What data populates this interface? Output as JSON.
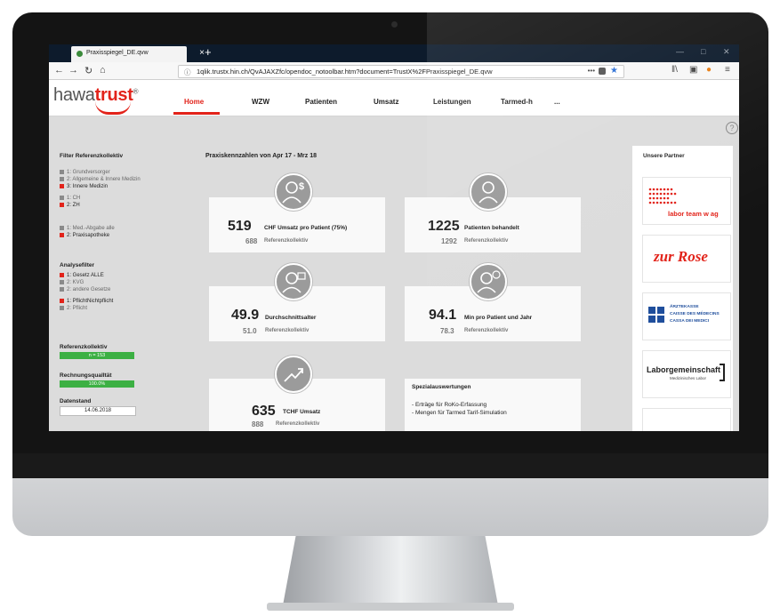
{
  "browser": {
    "tab_title": "Praxisspiegel_DE.qvw",
    "tab_close": "×",
    "new_tab": "+",
    "url": "1qlik.trustx.hin.ch/QvAJAXZfc/opendoc_notoolbar.htm?document=TrustX%2FPraxisspiegel_DE.qvw",
    "url_dots": "•••"
  },
  "app": {
    "logo_prefix": "hawa",
    "logo_brand": "trust",
    "logo_mark": "®",
    "nav": [
      "Home",
      "WZW",
      "Patienten",
      "Umsatz",
      "Leistungen",
      "Tarmed-h",
      "..."
    ],
    "active_nav": "Home",
    "help": "?"
  },
  "filters": {
    "title": "Filter Referenzkollektiv",
    "group1": [
      "1: Grundversorger",
      "2: Allgemeine & Innere Medizin",
      "3: Innere Medizin"
    ],
    "group2": [
      "1: CH",
      "2: ZH"
    ],
    "group3": [
      "1: Med.-Abgabe alle",
      "2: Praxisapotheke"
    ],
    "analyse_title": "Analysefilter",
    "analyse1": [
      "1: Gesetz ALLE",
      "2: KVG",
      "2: andere Gesetze"
    ],
    "analyse2": [
      "1: PflichtNichtpflicht",
      "2: Pflicht"
    ],
    "ref_title": "Referenzkollektiv",
    "ref_value": "n = 153",
    "quality_title": "RechnungsqualItät",
    "quality_value": "100.0%",
    "date_title": "Datenstand",
    "date_value": "14.06.2018"
  },
  "kpi": {
    "title": "Praxiskennzahlen von Apr 17 - Mrz 18",
    "ref_label": "Referenzkollektiv",
    "cards": [
      {
        "value": "519",
        "label": "CHF Umsatz pro Patient (75%)",
        "ref": "688",
        "icon": "dollar-person-icon"
      },
      {
        "value": "1225",
        "label": "Patienten behandelt",
        "ref": "1292",
        "icon": "person-icon"
      },
      {
        "value": "49.9",
        "label": "Durchschnittsalter",
        "ref": "51.0",
        "icon": "person-card-icon"
      },
      {
        "value": "94.1",
        "label": "Min pro Patient und Jahr",
        "ref": "78.3",
        "icon": "person-clock-icon"
      },
      {
        "value": "635",
        "label": "TCHF Umsatz",
        "ref": "888",
        "icon": "trend-up-icon"
      }
    ],
    "special": {
      "title": "Spezialauswertungen",
      "lines": [
        "- Erträge für RoKo-Erfassung",
        "- Mengen für Tarmed Tarif-Simulation"
      ]
    }
  },
  "partners": {
    "title": "Unsere Partner",
    "items": [
      "labor team w ag",
      "zur Rose",
      "ÄRZTEKASSE",
      "CAISSE DES MÉDECINS",
      "CASSA DEI MEDICI",
      "Laborgemeinschaft",
      "Medizinisches Labor"
    ]
  },
  "colors": {
    "brand_red": "#e2231a",
    "bar_green": "#3cb043",
    "icon_grey": "#9b9b9b",
    "browser_dark": "#0d1b2c"
  }
}
